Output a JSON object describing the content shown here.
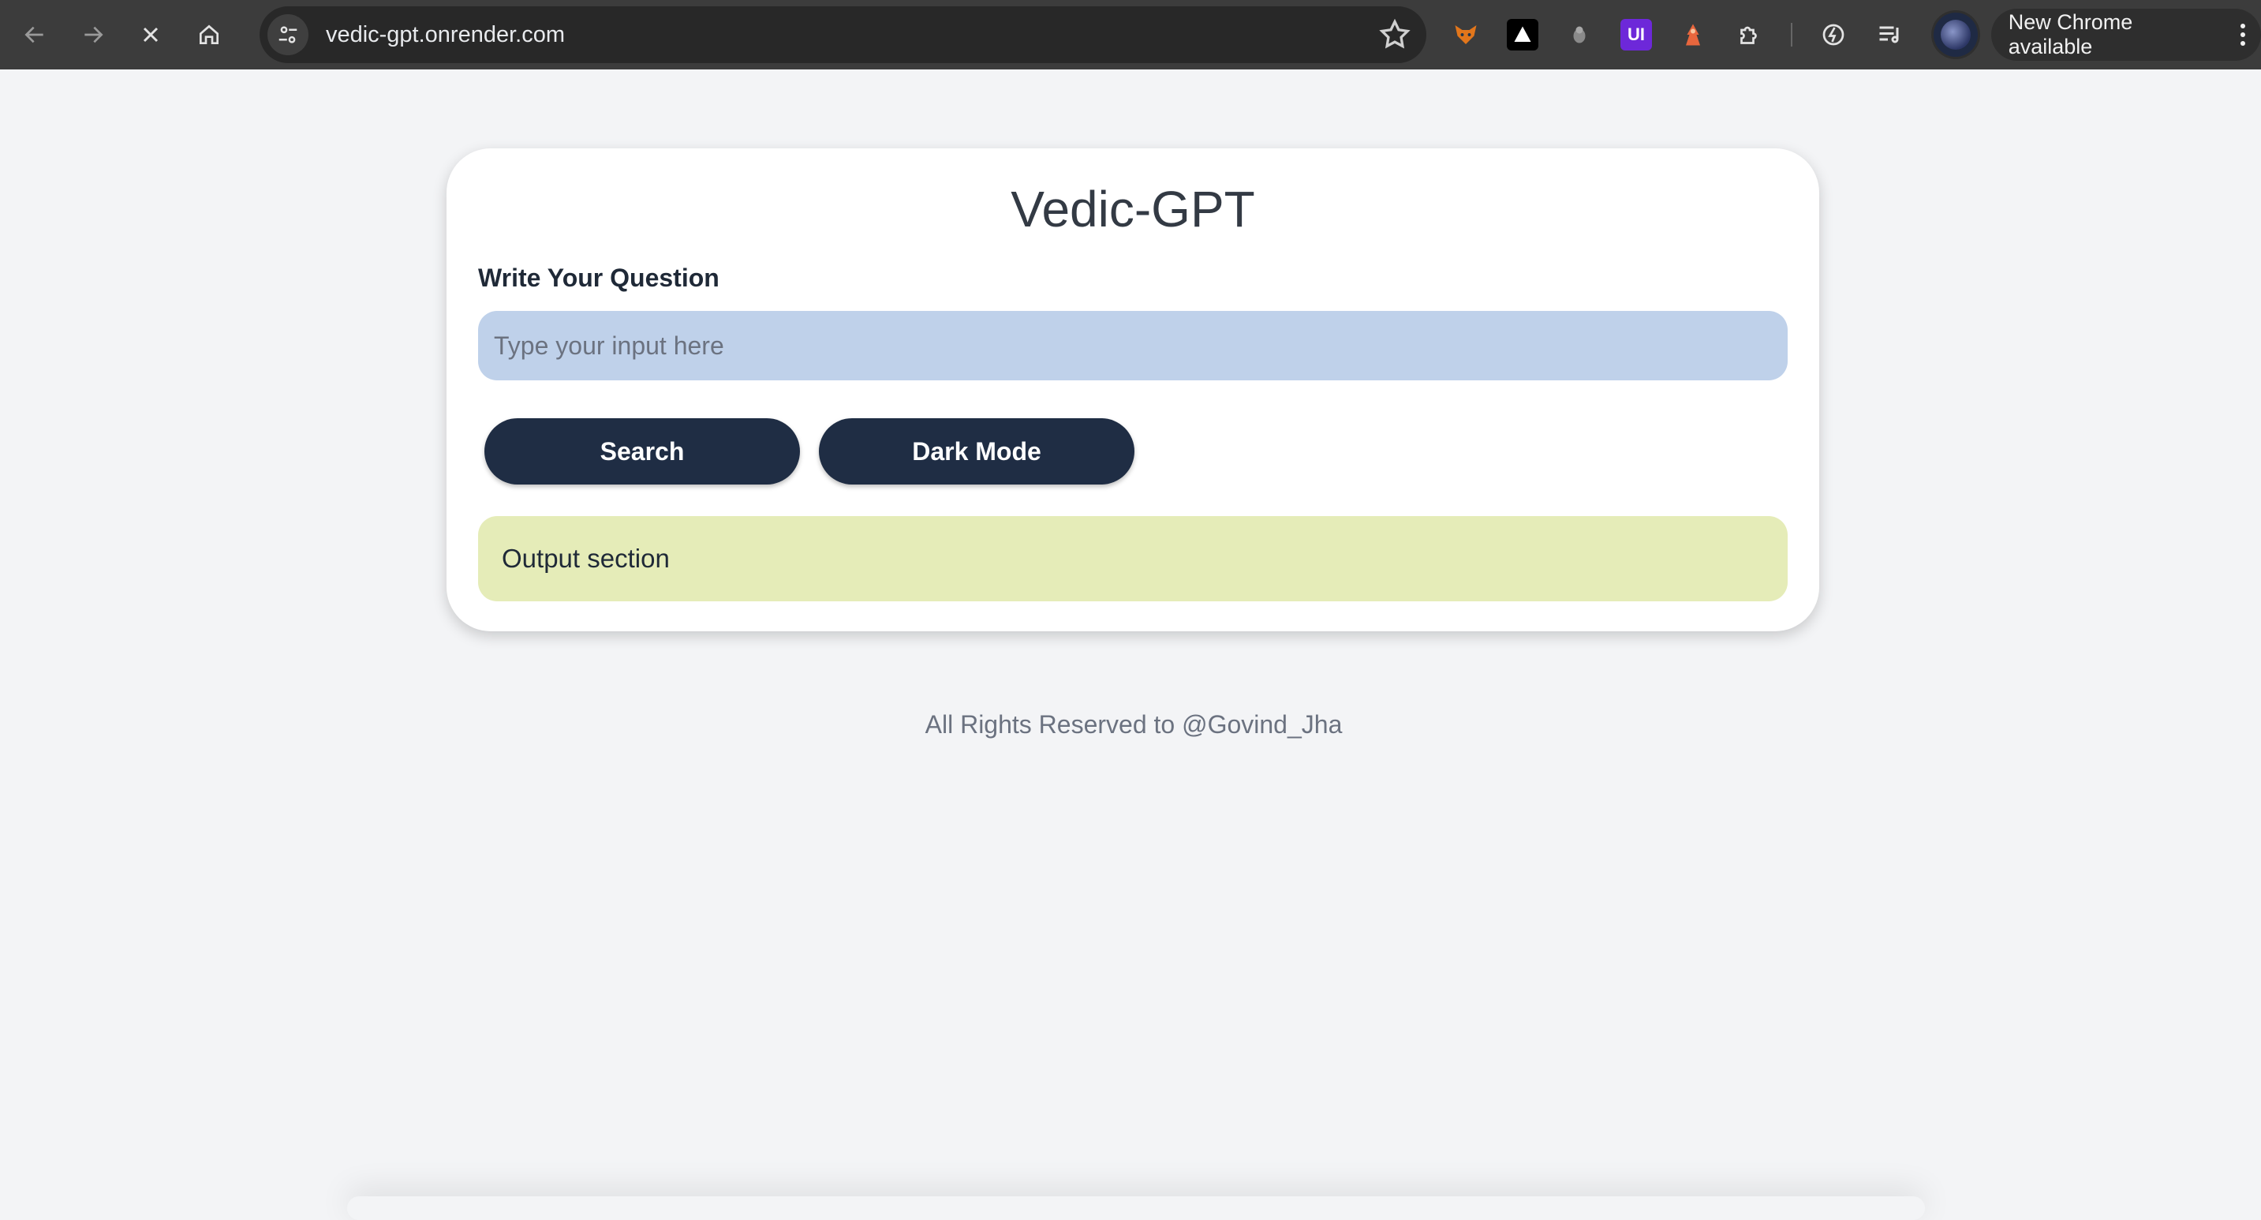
{
  "browser": {
    "url": "vedic-gpt.onrender.com",
    "update_label": "New Chrome available",
    "extensions": [
      {
        "icon": "fox-extension-icon"
      },
      {
        "icon": "triangle-extension-icon"
      },
      {
        "icon": "grey-dot-extension-icon"
      },
      {
        "icon": "ui-extension-icon",
        "label": "UI"
      },
      {
        "icon": "character-extension-icon"
      },
      {
        "icon": "puzzle-extension-icon"
      },
      {
        "icon": "speed-extension-icon"
      },
      {
        "icon": "playlist-extension-icon"
      }
    ],
    "ui_ext_color": "#6d28d9"
  },
  "app": {
    "title": "Vedic-GPT",
    "question_label": "Write Your Question",
    "input_placeholder": "Type your input here",
    "input_value": "",
    "search_label": "Search",
    "dark_mode_label": "Dark Mode",
    "output_text": "Output section",
    "footer": "All Rights Reserved to @Govind_Jha"
  },
  "colors": {
    "button_bg": "#1f2d44",
    "input_bg": "#bfd1ea",
    "output_bg": "#e5ecb8",
    "page_bg": "#f3f4f6"
  }
}
